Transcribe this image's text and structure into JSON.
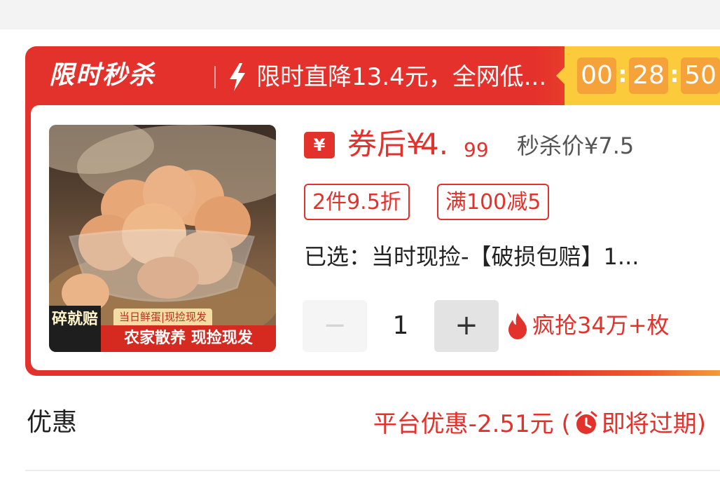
{
  "flash_sale": {
    "title": "限时秒杀",
    "promo_text": "限时直降13.4元，全网低...",
    "countdown": {
      "hours": "00",
      "minutes": "28",
      "seconds": "50"
    }
  },
  "product": {
    "image_badges": {
      "left": "碎就赔",
      "top": "当日鲜蛋|现捡现发",
      "bottom": "农家散养 现捡现发"
    },
    "coupon_icon_text": "¥",
    "price_prefix": "券后¥",
    "price_integer": "4.",
    "price_decimal": "99",
    "seckill_price": "秒杀价¥7.5",
    "tags": [
      "2件9.5折",
      "满100减5"
    ],
    "selected": "已选：当时现捡-【破损包赔】1...",
    "quantity": "1",
    "minus_label": "−",
    "plus_label": "+",
    "hot_text": "疯抢34万+枚"
  },
  "discount": {
    "label": "优惠",
    "value_prefix": "平台优惠-2.51元 (",
    "value_suffix": "即将过期)"
  },
  "colors": {
    "brand_red": "#e3312c",
    "countdown_yellow": "#fccb3c",
    "countdown_box": "#f6a23a"
  }
}
